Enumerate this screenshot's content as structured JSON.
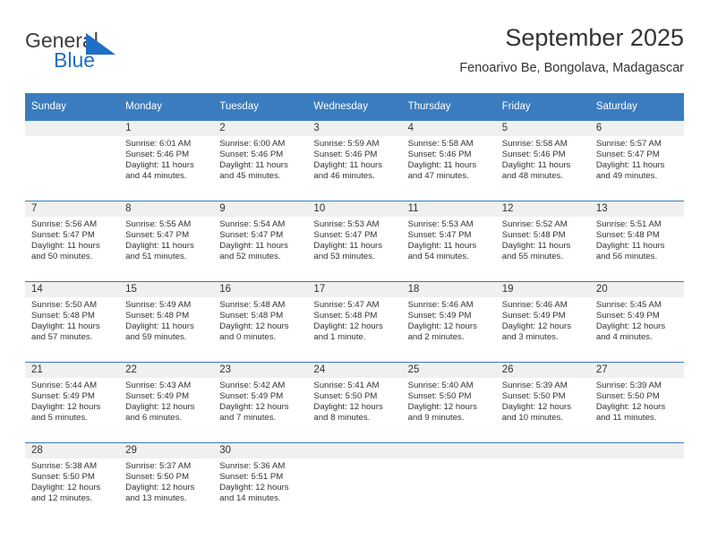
{
  "brand": {
    "name_part1": "General",
    "name_part2": "Blue",
    "flag_color": "#1f6fc4"
  },
  "header": {
    "title": "September 2025",
    "subtitle": "Fenoarivo Be, Bongolava, Madagascar",
    "header_bg": "#3a7cbe",
    "daynum_bg": "#f0f0f0"
  },
  "weekdays": [
    "Sunday",
    "Monday",
    "Tuesday",
    "Wednesday",
    "Thursday",
    "Friday",
    "Saturday"
  ],
  "weeks": [
    [
      {
        "day": "",
        "sunrise": "",
        "sunset": "",
        "daylight1": "",
        "daylight2": ""
      },
      {
        "day": "1",
        "sunrise": "Sunrise: 6:01 AM",
        "sunset": "Sunset: 5:46 PM",
        "daylight1": "Daylight: 11 hours",
        "daylight2": "and 44 minutes."
      },
      {
        "day": "2",
        "sunrise": "Sunrise: 6:00 AM",
        "sunset": "Sunset: 5:46 PM",
        "daylight1": "Daylight: 11 hours",
        "daylight2": "and 45 minutes."
      },
      {
        "day": "3",
        "sunrise": "Sunrise: 5:59 AM",
        "sunset": "Sunset: 5:46 PM",
        "daylight1": "Daylight: 11 hours",
        "daylight2": "and 46 minutes."
      },
      {
        "day": "4",
        "sunrise": "Sunrise: 5:58 AM",
        "sunset": "Sunset: 5:46 PM",
        "daylight1": "Daylight: 11 hours",
        "daylight2": "and 47 minutes."
      },
      {
        "day": "5",
        "sunrise": "Sunrise: 5:58 AM",
        "sunset": "Sunset: 5:46 PM",
        "daylight1": "Daylight: 11 hours",
        "daylight2": "and 48 minutes."
      },
      {
        "day": "6",
        "sunrise": "Sunrise: 5:57 AM",
        "sunset": "Sunset: 5:47 PM",
        "daylight1": "Daylight: 11 hours",
        "daylight2": "and 49 minutes."
      }
    ],
    [
      {
        "day": "7",
        "sunrise": "Sunrise: 5:56 AM",
        "sunset": "Sunset: 5:47 PM",
        "daylight1": "Daylight: 11 hours",
        "daylight2": "and 50 minutes."
      },
      {
        "day": "8",
        "sunrise": "Sunrise: 5:55 AM",
        "sunset": "Sunset: 5:47 PM",
        "daylight1": "Daylight: 11 hours",
        "daylight2": "and 51 minutes."
      },
      {
        "day": "9",
        "sunrise": "Sunrise: 5:54 AM",
        "sunset": "Sunset: 5:47 PM",
        "daylight1": "Daylight: 11 hours",
        "daylight2": "and 52 minutes."
      },
      {
        "day": "10",
        "sunrise": "Sunrise: 5:53 AM",
        "sunset": "Sunset: 5:47 PM",
        "daylight1": "Daylight: 11 hours",
        "daylight2": "and 53 minutes."
      },
      {
        "day": "11",
        "sunrise": "Sunrise: 5:53 AM",
        "sunset": "Sunset: 5:47 PM",
        "daylight1": "Daylight: 11 hours",
        "daylight2": "and 54 minutes."
      },
      {
        "day": "12",
        "sunrise": "Sunrise: 5:52 AM",
        "sunset": "Sunset: 5:48 PM",
        "daylight1": "Daylight: 11 hours",
        "daylight2": "and 55 minutes."
      },
      {
        "day": "13",
        "sunrise": "Sunrise: 5:51 AM",
        "sunset": "Sunset: 5:48 PM",
        "daylight1": "Daylight: 11 hours",
        "daylight2": "and 56 minutes."
      }
    ],
    [
      {
        "day": "14",
        "sunrise": "Sunrise: 5:50 AM",
        "sunset": "Sunset: 5:48 PM",
        "daylight1": "Daylight: 11 hours",
        "daylight2": "and 57 minutes."
      },
      {
        "day": "15",
        "sunrise": "Sunrise: 5:49 AM",
        "sunset": "Sunset: 5:48 PM",
        "daylight1": "Daylight: 11 hours",
        "daylight2": "and 59 minutes."
      },
      {
        "day": "16",
        "sunrise": "Sunrise: 5:48 AM",
        "sunset": "Sunset: 5:48 PM",
        "daylight1": "Daylight: 12 hours",
        "daylight2": "and 0 minutes."
      },
      {
        "day": "17",
        "sunrise": "Sunrise: 5:47 AM",
        "sunset": "Sunset: 5:48 PM",
        "daylight1": "Daylight: 12 hours",
        "daylight2": "and 1 minute."
      },
      {
        "day": "18",
        "sunrise": "Sunrise: 5:46 AM",
        "sunset": "Sunset: 5:49 PM",
        "daylight1": "Daylight: 12 hours",
        "daylight2": "and 2 minutes."
      },
      {
        "day": "19",
        "sunrise": "Sunrise: 5:46 AM",
        "sunset": "Sunset: 5:49 PM",
        "daylight1": "Daylight: 12 hours",
        "daylight2": "and 3 minutes."
      },
      {
        "day": "20",
        "sunrise": "Sunrise: 5:45 AM",
        "sunset": "Sunset: 5:49 PM",
        "daylight1": "Daylight: 12 hours",
        "daylight2": "and 4 minutes."
      }
    ],
    [
      {
        "day": "21",
        "sunrise": "Sunrise: 5:44 AM",
        "sunset": "Sunset: 5:49 PM",
        "daylight1": "Daylight: 12 hours",
        "daylight2": "and 5 minutes."
      },
      {
        "day": "22",
        "sunrise": "Sunrise: 5:43 AM",
        "sunset": "Sunset: 5:49 PM",
        "daylight1": "Daylight: 12 hours",
        "daylight2": "and 6 minutes."
      },
      {
        "day": "23",
        "sunrise": "Sunrise: 5:42 AM",
        "sunset": "Sunset: 5:49 PM",
        "daylight1": "Daylight: 12 hours",
        "daylight2": "and 7 minutes."
      },
      {
        "day": "24",
        "sunrise": "Sunrise: 5:41 AM",
        "sunset": "Sunset: 5:50 PM",
        "daylight1": "Daylight: 12 hours",
        "daylight2": "and 8 minutes."
      },
      {
        "day": "25",
        "sunrise": "Sunrise: 5:40 AM",
        "sunset": "Sunset: 5:50 PM",
        "daylight1": "Daylight: 12 hours",
        "daylight2": "and 9 minutes."
      },
      {
        "day": "26",
        "sunrise": "Sunrise: 5:39 AM",
        "sunset": "Sunset: 5:50 PM",
        "daylight1": "Daylight: 12 hours",
        "daylight2": "and 10 minutes."
      },
      {
        "day": "27",
        "sunrise": "Sunrise: 5:39 AM",
        "sunset": "Sunset: 5:50 PM",
        "daylight1": "Daylight: 12 hours",
        "daylight2": "and 11 minutes."
      }
    ],
    [
      {
        "day": "28",
        "sunrise": "Sunrise: 5:38 AM",
        "sunset": "Sunset: 5:50 PM",
        "daylight1": "Daylight: 12 hours",
        "daylight2": "and 12 minutes."
      },
      {
        "day": "29",
        "sunrise": "Sunrise: 5:37 AM",
        "sunset": "Sunset: 5:50 PM",
        "daylight1": "Daylight: 12 hours",
        "daylight2": "and 13 minutes."
      },
      {
        "day": "30",
        "sunrise": "Sunrise: 5:36 AM",
        "sunset": "Sunset: 5:51 PM",
        "daylight1": "Daylight: 12 hours",
        "daylight2": "and 14 minutes."
      },
      {
        "day": "",
        "sunrise": "",
        "sunset": "",
        "daylight1": "",
        "daylight2": ""
      },
      {
        "day": "",
        "sunrise": "",
        "sunset": "",
        "daylight1": "",
        "daylight2": ""
      },
      {
        "day": "",
        "sunrise": "",
        "sunset": "",
        "daylight1": "",
        "daylight2": ""
      },
      {
        "day": "",
        "sunrise": "",
        "sunset": "",
        "daylight1": "",
        "daylight2": ""
      }
    ]
  ]
}
